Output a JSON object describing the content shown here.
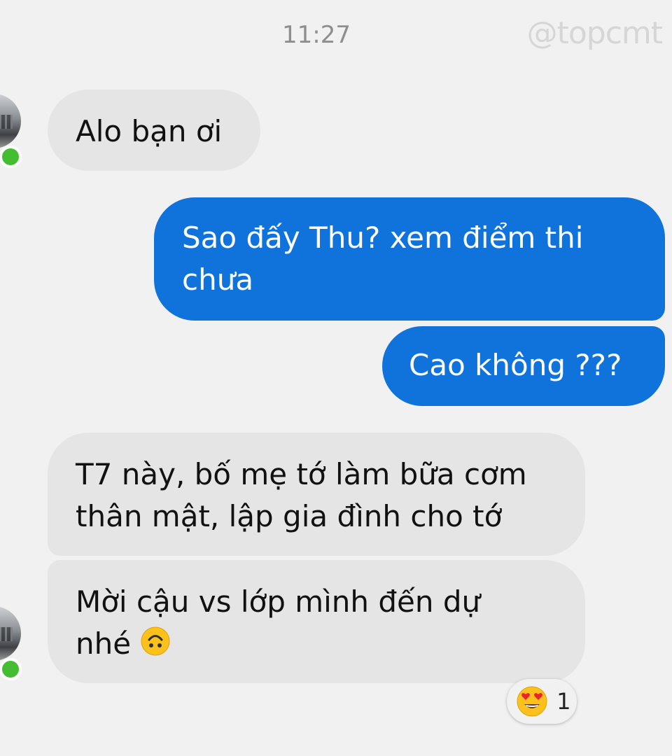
{
  "header": {
    "timestamp": "11:27",
    "watermark": "@topcmt"
  },
  "messages": [
    {
      "direction": "received",
      "text": "Alo bạn ơi"
    },
    {
      "direction": "sent",
      "lines": [
        "Sao đấy Thu? xem điểm thi",
        "chưa"
      ]
    },
    {
      "direction": "sent",
      "text": "Cao không ???"
    },
    {
      "direction": "received",
      "lines": [
        "T7 này, bố mẹ tớ làm bữa cơm",
        "thân mật, lập gia đình cho tớ"
      ]
    },
    {
      "direction": "received",
      "lines": [
        "Mời cậu vs lớp mình đến dự",
        "nhé"
      ],
      "trailing_emoji": "upside-down-face-icon"
    }
  ],
  "reaction": {
    "emoji": "heart-eyes-icon",
    "count": "1"
  },
  "colors": {
    "background": "#f1f1f1",
    "sent_bubble": "#0f73db",
    "received_bubble": "#e5e5e5",
    "online_indicator": "#44bd32"
  }
}
